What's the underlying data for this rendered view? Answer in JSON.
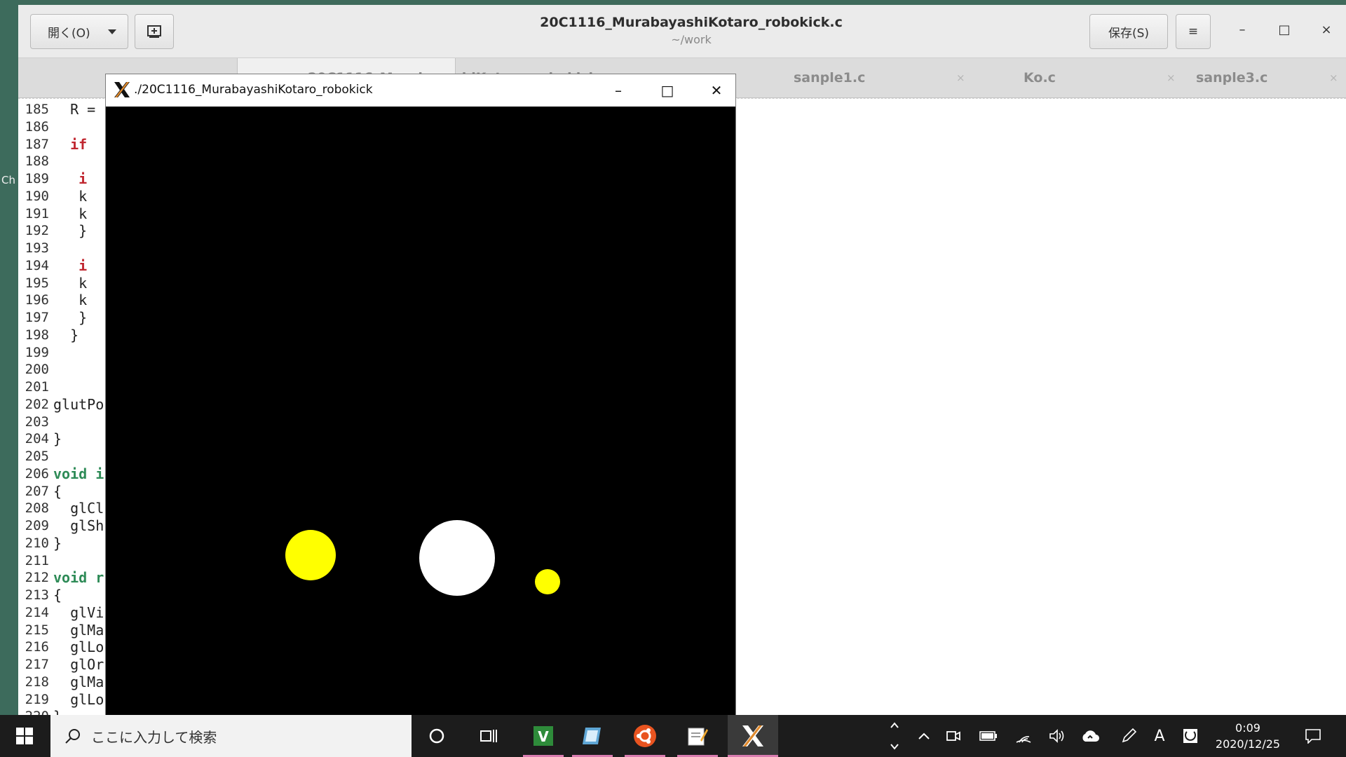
{
  "desktop": {
    "edge_text": "Ch"
  },
  "gedit": {
    "open_label": "開く(O)",
    "save_label": "保存(S)",
    "title": "20C1116_MurabayashiKotaro_robokick.c",
    "subtitle": "~/work",
    "minimize_glyph": "–",
    "maximize_glyph": "□",
    "close_glyph": "×",
    "menu_glyph": "≡",
    "tabs": [
      {
        "label": "20C1116_MurabayashiKotaro_robokick.c"
      },
      {
        "label": "sanple1.c"
      },
      {
        "label": "Ko.c"
      },
      {
        "label": "sanple3.c"
      }
    ],
    "tab_close": "×",
    "lines": [
      {
        "n": "185",
        "text": "  R ="
      },
      {
        "n": "186",
        "text": ""
      },
      {
        "n": "187",
        "text": "  if"
      },
      {
        "n": "188",
        "text": ""
      },
      {
        "n": "189",
        "text": "   i"
      },
      {
        "n": "190",
        "text": "   k"
      },
      {
        "n": "191",
        "text": "   k"
      },
      {
        "n": "192",
        "text": "   }"
      },
      {
        "n": "193",
        "text": ""
      },
      {
        "n": "194",
        "text": "   i"
      },
      {
        "n": "195",
        "text": "   k"
      },
      {
        "n": "196",
        "text": "   k"
      },
      {
        "n": "197",
        "text": "   }"
      },
      {
        "n": "198",
        "text": "  }"
      },
      {
        "n": "199",
        "text": ""
      },
      {
        "n": "200",
        "text": ""
      },
      {
        "n": "201",
        "text": ""
      },
      {
        "n": "202",
        "text": "glutPo"
      },
      {
        "n": "203",
        "text": ""
      },
      {
        "n": "204",
        "text": "}"
      },
      {
        "n": "205",
        "text": ""
      },
      {
        "n": "206",
        "text": "void i"
      },
      {
        "n": "207",
        "text": "{"
      },
      {
        "n": "208",
        "text": "  glCl"
      },
      {
        "n": "209",
        "text": "  glSh"
      },
      {
        "n": "210",
        "text": "}"
      },
      {
        "n": "211",
        "text": ""
      },
      {
        "n": "212",
        "text": "void r"
      },
      {
        "n": "213",
        "text": "{"
      },
      {
        "n": "214",
        "text": "  glVi"
      },
      {
        "n": "215",
        "text": "  glMa"
      },
      {
        "n": "216",
        "text": "  glLo"
      },
      {
        "n": "217",
        "text": "  glOr"
      },
      {
        "n": "218",
        "text": "  glMa"
      },
      {
        "n": "219",
        "text": "  glLo"
      },
      {
        "n": "220",
        "text": "}"
      }
    ]
  },
  "xwindow": {
    "title": "./20C1116_MurabayashiKotaro_robokick",
    "minimize_glyph": "–",
    "maximize_glyph": "□",
    "close_glyph": "✕",
    "balls": [
      {
        "color": "#ffff00"
      },
      {
        "color": "#ffffff"
      },
      {
        "color": "#ffff00"
      }
    ]
  },
  "taskbar": {
    "search_placeholder": "ここに入力して検索",
    "time": "0:09",
    "date": "2020/12/25",
    "ime_label": "A",
    "accent": "#d97cb0"
  }
}
